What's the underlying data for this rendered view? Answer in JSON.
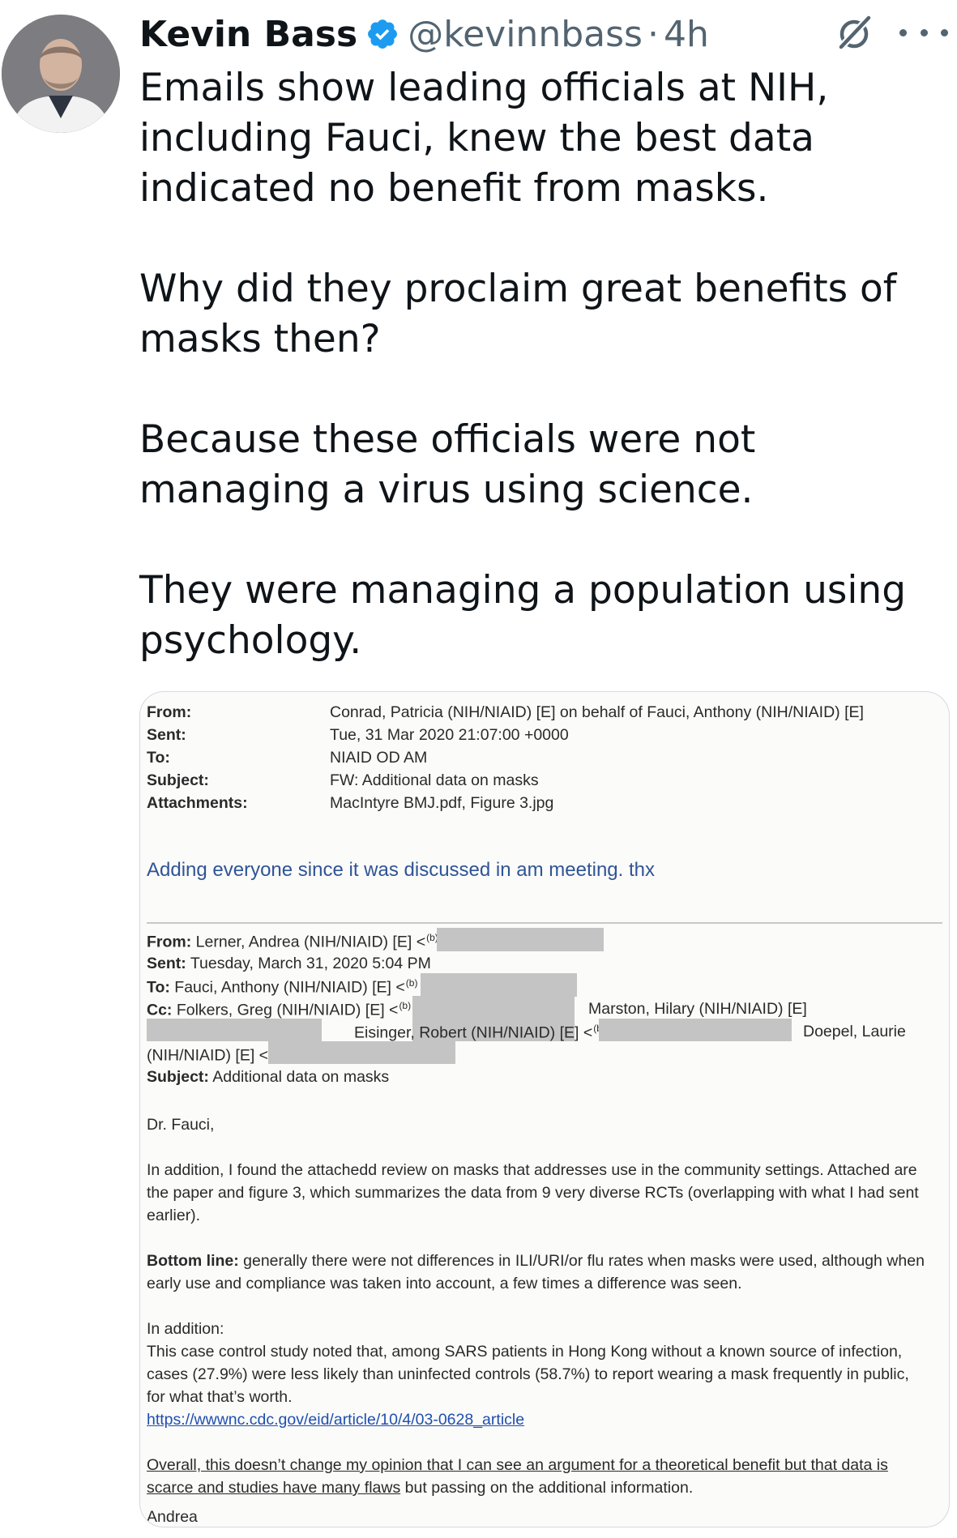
{
  "tweet": {
    "author_name": "Kevin Bass",
    "handle": "@kevinnbass",
    "separator": "·",
    "time": "4h",
    "paragraphs": [
      "Emails show leading officials at NIH, including Fauci, knew the best data indicated no benefit from masks.",
      "Why did they proclaim great benefits of masks then?",
      "Because these officials were not managing a virus using science.",
      "They were managing a population using psychology."
    ]
  },
  "email": {
    "header": {
      "from_label": "From:",
      "from_value": "Conrad, Patricia (NIH/NIAID) [E] on behalf of Fauci, Anthony (NIH/NIAID) [E]",
      "sent_label": "Sent:",
      "sent_value": "Tue, 31 Mar 2020 21:07:00 +0000",
      "to_label": "To:",
      "to_value": "NIAID OD AM",
      "subject_label": "Subject:",
      "subject_value": "FW: Additional data on masks",
      "attachments_label": "Attachments:",
      "attachments_value": "MacIntyre BMJ.pdf, Figure 3.jpg"
    },
    "forward_note": "Adding everyone since it was discussed in am meeting. thx",
    "forwarded": {
      "from_label": "From:",
      "from_value": "Lerner, Andrea (NIH/NIAID) [E] <",
      "sent_label": "Sent:",
      "sent_value": "Tuesday, March 31, 2020 5:04 PM",
      "to_label": "To:",
      "to_value": "Fauci, Anthony (NIH/NIAID) [E] <",
      "cc_label": "Cc:",
      "cc_value": "Folkers, Greg (NIH/NIAID) [E] <",
      "cc_marston": "Marston, Hilary (NIH/NIAID) [E]",
      "cc_eisinger": "Eisinger, Robert (NIH/NIAID) [E] <",
      "cc_doepel": "Doepel, Laurie",
      "cc_doepel_cont": "(NIH/NIAID) [E] <",
      "lt": "<",
      "subject_label": "Subject:",
      "subject_value": "Additional data on masks",
      "redaction_tag": "(b) (6)"
    },
    "greeting": "Dr. Fauci,",
    "para1": "In addition, I found the attachedd review on masks that addresses use in the community settings.  Attached are the paper and figure 3, which summarizes the data from 9 very diverse RCTs (overlapping with what I had sent earlier).",
    "bottom_line_label": "Bottom line:",
    "bottom_line_text": " generally there were not differences in ILI/URI/or flu rates when masks were used, although when early use and compliance was taken into account, a few times a difference was seen.",
    "in_addition_label": "In addition:",
    "case_control_text": "This case control study noted that, among SARS patients in Hong Kong without a known source of infection, cases (27.9%) were less likely than uninfected controls (58.7%) to report wearing a mask frequently in public, for what that’s worth.",
    "link": "https://wwwnc.cdc.gov/eid/article/10/4/03-0628_article",
    "overall_underlined": "Overall, this doesn’t change my opinion that I can see an argument for a theoretical benefit but that data is scarce and studies have many flaws",
    "overall_rest": " but passing on the additional information.",
    "signature": "Andrea"
  },
  "colors": {
    "text": "#0f1419",
    "secondary": "#536471",
    "verified": "#1d9bf0",
    "email_blue": "#2f5496",
    "link": "#1f4fb0",
    "redaction": "#c4c4c4"
  },
  "icons": [
    "verified-badge-icon",
    "grok-icon",
    "more-options-icon"
  ]
}
